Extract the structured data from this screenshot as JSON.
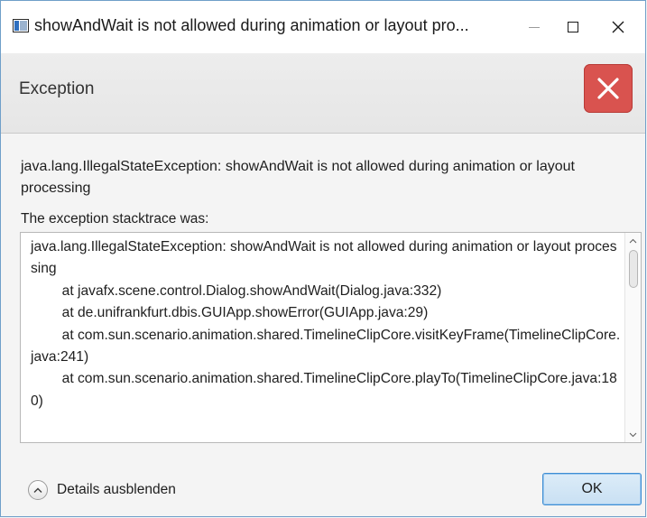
{
  "window": {
    "title": "showAndWait is not allowed during animation or layout pro..."
  },
  "header": {
    "title": "Exception",
    "icon": "error-x-icon",
    "badge_color": "#d9534f"
  },
  "content": {
    "message": "java.lang.IllegalStateException: showAndWait is not allowed during animation or layout processing",
    "stacktrace_label": "The exception stacktrace was:",
    "stacktrace_lines": [
      "java.lang.IllegalStateException: showAndWait is not allowed during animation or layout processing",
      "\tat javafx.scene.control.Dialog.showAndWait(Dialog.java:332)",
      "\tat de.unifrankfurt.dbis.GUIApp.showError(GUIApp.java:29)",
      "\tat com.sun.scenario.animation.shared.TimelineClipCore.visitKeyFrame(TimelineClipCore.java:241)",
      "\tat com.sun.scenario.animation.shared.TimelineClipCore.playTo(TimelineClipCore.java:180)"
    ]
  },
  "footer": {
    "details_label": "Details ausblenden",
    "ok_label": "OK",
    "accent": "#3e8dd3"
  }
}
